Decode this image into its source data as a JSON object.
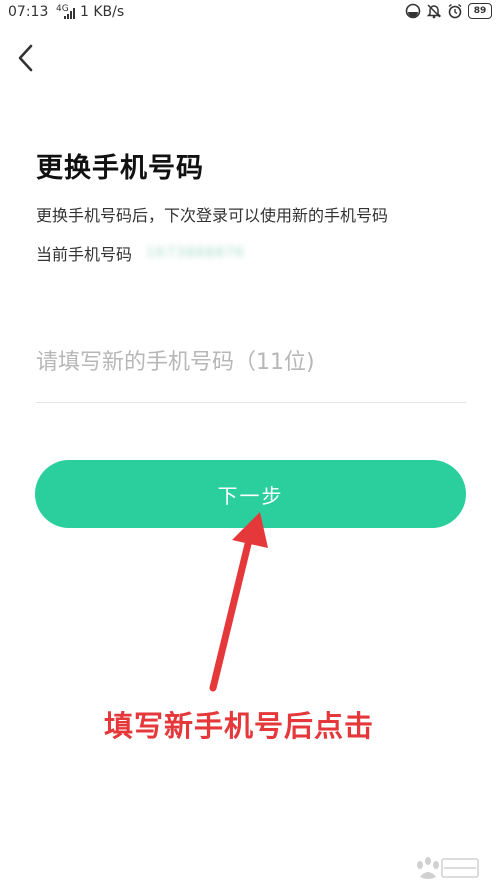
{
  "status_bar": {
    "time": "07:13",
    "network": "4G",
    "speed": "1 KB/s",
    "battery": "89"
  },
  "icons": {
    "back": "chevron-left-icon",
    "data_saver": "data-saver-icon",
    "mute": "bell-off-icon",
    "alarm": "alarm-icon"
  },
  "page": {
    "title": "更换手机号码",
    "subtitle": "更换手机号码后，下次登录可以使用新的手机号码",
    "current_label": "当前手机号码",
    "current_number": "1673888876",
    "input_placeholder": "请填写新的手机号码（11位)",
    "next_label": "下一步"
  },
  "annotation": {
    "text": "填写新手机号后点击",
    "color": "#e5383b"
  },
  "colors": {
    "accent": "#2bcf9d"
  }
}
